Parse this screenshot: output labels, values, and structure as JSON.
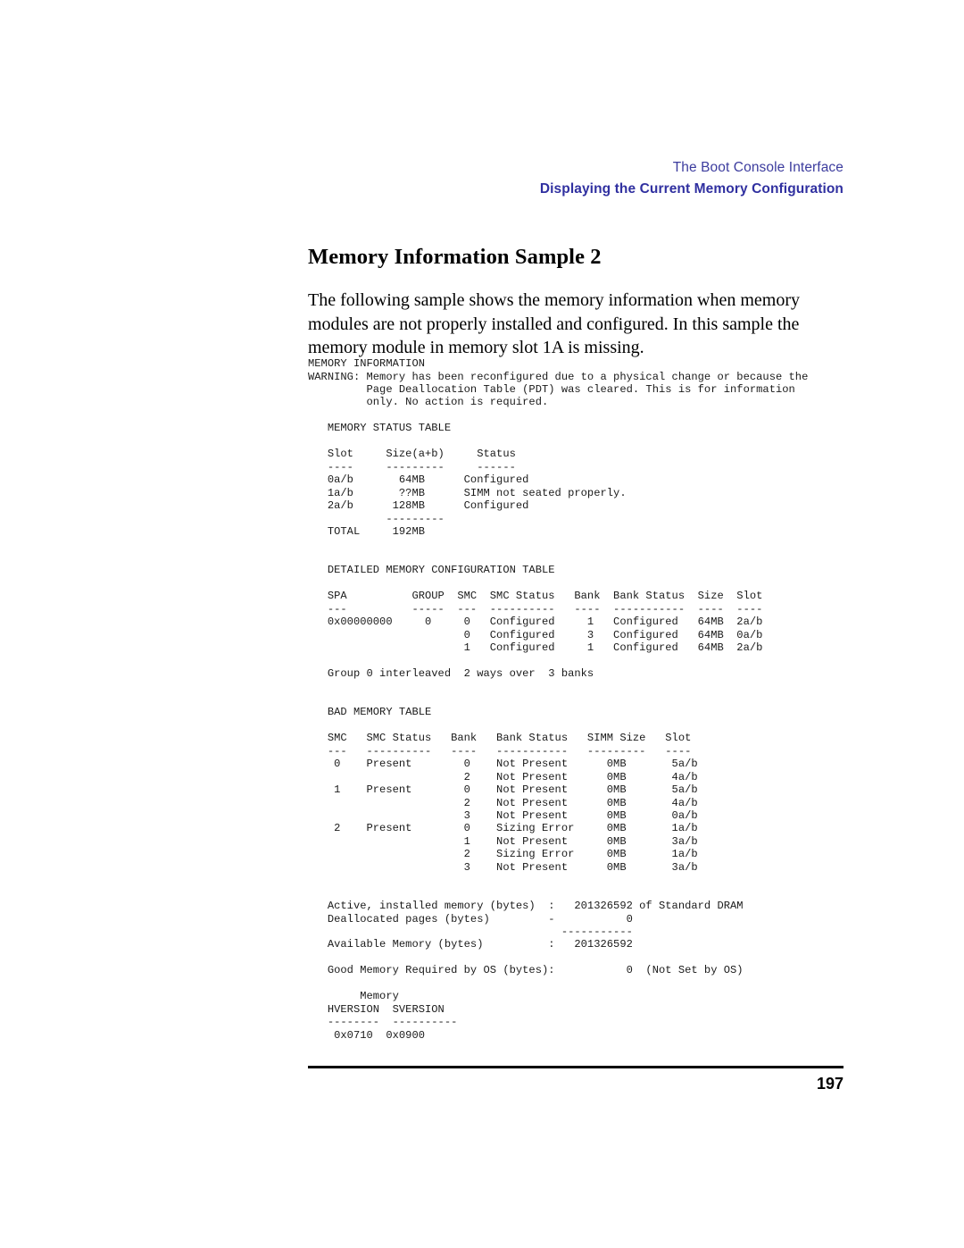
{
  "header": {
    "running_head": "The Boot Console Interface",
    "section_head": "Displaying the Current Memory Configuration",
    "color": "#3c3c9e"
  },
  "section": {
    "title": "Memory Information Sample 2",
    "intro": "The following sample shows the memory information when memory modules are not properly installed and configured. In this sample the memory module in memory slot 1A is missing."
  },
  "console": {
    "title": "MEMORY INFORMATION",
    "warning": {
      "label": "WARNING:",
      "lines": [
        "Memory has been reconfigured due to a physical change or because the",
        "Page Deallocation Table (PDT) was cleared. This is for information",
        "only. No action is required."
      ]
    },
    "memory_status_table": {
      "title": "MEMORY STATUS TABLE",
      "columns": [
        "Slot",
        "Size(a+b)",
        "Status"
      ],
      "rules": [
        "----",
        "---------",
        "------"
      ],
      "rows": [
        [
          "0a/b",
          "64MB",
          "Configured"
        ],
        [
          "1a/b",
          "??MB",
          "SIMM not seated properly."
        ],
        [
          "2a/b",
          "128MB",
          "Configured"
        ]
      ],
      "total_rule": "---------",
      "total_label": "TOTAL",
      "total_value": "192MB"
    },
    "detailed_memory_configuration_table": {
      "title": "DETAILED MEMORY CONFIGURATION TABLE",
      "columns": [
        "SPA",
        "GROUP",
        "SMC",
        "SMC Status",
        "Bank",
        "Bank Status",
        "Size",
        "Slot"
      ],
      "rules": [
        "---",
        "-----",
        "---",
        "----------",
        "----",
        "-----------",
        "----",
        "----"
      ],
      "rows": [
        [
          "0x00000000",
          "0",
          "0",
          "Configured",
          "1",
          "Configured",
          "64MB",
          "2a/b"
        ],
        [
          "",
          "",
          "0",
          "Configured",
          "3",
          "Configured",
          "64MB",
          "0a/b"
        ],
        [
          "",
          "",
          "1",
          "Configured",
          "1",
          "Configured",
          "64MB",
          "2a/b"
        ]
      ],
      "note": "Group 0 interleaved  2 ways over  3 banks"
    },
    "bad_memory_table": {
      "title": "BAD MEMORY TABLE",
      "columns": [
        "SMC",
        "SMC Status",
        "Bank",
        "Bank Status",
        "SIMM Size",
        "Slot"
      ],
      "rules": [
        "---",
        "----------",
        "----",
        "-----------",
        "---------",
        "----"
      ],
      "rows": [
        [
          "0",
          "Present",
          "0",
          "Not Present",
          "0MB",
          "5a/b"
        ],
        [
          "",
          "",
          "2",
          "Not Present",
          "0MB",
          "4a/b"
        ],
        [
          "1",
          "Present",
          "0",
          "Not Present",
          "0MB",
          "5a/b"
        ],
        [
          "",
          "",
          "2",
          "Not Present",
          "0MB",
          "4a/b"
        ],
        [
          "",
          "",
          "3",
          "Not Present",
          "0MB",
          "0a/b"
        ],
        [
          "2",
          "Present",
          "0",
          "Sizing Error",
          "0MB",
          "1a/b"
        ],
        [
          "",
          "",
          "1",
          "Not Present",
          "0MB",
          "3a/b"
        ],
        [
          "",
          "",
          "2",
          "Sizing Error",
          "0MB",
          "1a/b"
        ],
        [
          "",
          "",
          "3",
          "Not Present",
          "0MB",
          "3a/b"
        ]
      ]
    },
    "summary": {
      "active_label": "Active, installed memory (bytes)",
      "active_sep": ":",
      "active_value": "201326592",
      "active_suffix": "of Standard DRAM",
      "dealloc_label": "Deallocated pages (bytes)",
      "dealloc_sep": "-",
      "dealloc_value": "0",
      "sum_rule": "-----------",
      "available_label": "Available Memory (bytes)",
      "available_sep": ":",
      "available_value": "201326592",
      "good_label": "Good Memory Required by OS (bytes):",
      "good_value": "0",
      "good_suffix": "(Not Set by OS)"
    },
    "version_table": {
      "group_label": "Memory",
      "columns": [
        "HVERSION",
        "SVERSION"
      ],
      "rules": [
        "--------",
        "----------"
      ],
      "values": [
        "0x0710",
        "0x0900"
      ]
    }
  },
  "footer": {
    "page_number": "197"
  },
  "console_text": "MEMORY INFORMATION\nWARNING: Memory has been reconfigured due to a physical change or because the\n         Page Deallocation Table (PDT) was cleared. This is for information\n         only. No action is required.\n\n   MEMORY STATUS TABLE\n\n   Slot     Size(a+b)     Status\n   ----     ---------     ------\n   0a/b       64MB      Configured\n   1a/b       ??MB      SIMM not seated properly.\n   2a/b      128MB      Configured\n            ---------\n   TOTAL     192MB\n\n\n   DETAILED MEMORY CONFIGURATION TABLE\n\n   SPA          GROUP  SMC  SMC Status   Bank  Bank Status  Size  Slot\n   ---          -----  ---  ----------   ----  -----------  ----  ----\n   0x00000000     0     0   Configured     1   Configured   64MB  2a/b\n                        0   Configured     3   Configured   64MB  0a/b\n                        1   Configured     1   Configured   64MB  2a/b\n\n   Group 0 interleaved  2 ways over  3 banks\n\n\n   BAD MEMORY TABLE\n\n   SMC   SMC Status   Bank   Bank Status   SIMM Size   Slot\n   ---   ----------   ----   -----------   ---------   ----\n    0    Present        0    Not Present      0MB       5a/b\n                        2    Not Present      0MB       4a/b\n    1    Present        0    Not Present      0MB       5a/b\n                        2    Not Present      0MB       4a/b\n                        3    Not Present      0MB       0a/b\n    2    Present        0    Sizing Error     0MB       1a/b\n                        1    Not Present      0MB       3a/b\n                        2    Sizing Error     0MB       1a/b\n                        3    Not Present      0MB       3a/b\n\n\n   Active, installed memory (bytes)  :   201326592 of Standard DRAM\n   Deallocated pages (bytes)         -           0\n                                       -----------\n   Available Memory (bytes)          :   201326592\n\n   Good Memory Required by OS (bytes):           0  (Not Set by OS)\n\n        Memory\n   HVERSION  SVERSION\n   --------  ----------\n    0x0710  0x0900"
}
